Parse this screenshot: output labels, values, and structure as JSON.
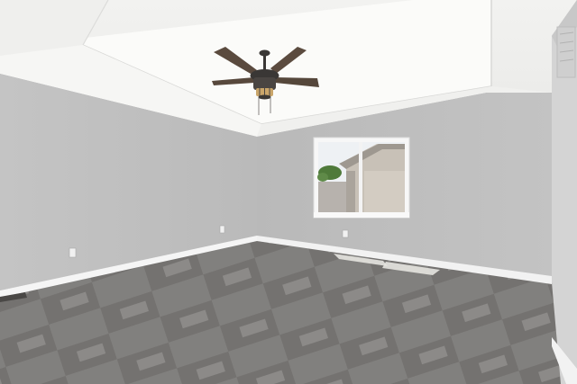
{
  "scene": {
    "subject": "empty-bedroom",
    "colors": {
      "wall_left": "#c2c2c2",
      "wall_back": "#bdbdbd",
      "wall_right": "#d2d2d2",
      "ceiling": "#f3f3f1",
      "tray": "#fafaf8",
      "baseboard": "#f4f4f4",
      "carpet": "#8a8886",
      "carpet_dark": "#6f6d6b",
      "carpet_light": "#a3a19f",
      "fan_blade": "#5a4a3e",
      "fan_body": "#3a3735",
      "fan_light": "#c9a56a",
      "window_frame": "#f6f6f6",
      "window_sky": "#eef1f4",
      "neighbor_house": "#c9c2b8",
      "tree": "#4f7a3a"
    },
    "objects": [
      "ceiling-fan-icon",
      "window",
      "floor-vent",
      "outlet",
      "carpet",
      "sunlight-patch"
    ]
  }
}
